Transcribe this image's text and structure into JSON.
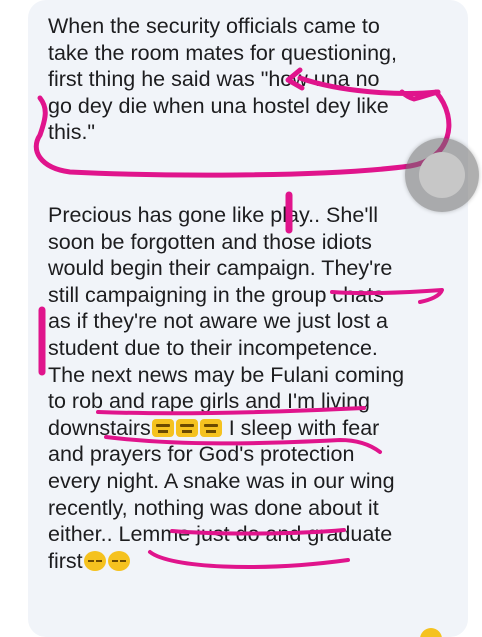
{
  "post": {
    "paragraph_1": {
      "line_1": "When the security officials came to",
      "line_2": "take the room mates for questioning,",
      "line_3": "first thing he said was \"how una no",
      "line_4": "go dey die when una hostel dey like",
      "line_5": "this.\""
    },
    "paragraph_2": {
      "line_1": "Precious has gone like play.. She'll",
      "line_2": "soon be forgotten and those idiots",
      "line_3": "would begin their campaign. They're",
      "line_4": "still campaigning in the group chats",
      "line_5": "as if they're not aware we just lost a",
      "line_6": "student due to their incompetence.",
      "line_7": "The next news may be Fulani coming",
      "line_8": "to rob and rape girls and I'm living",
      "line_9a": "downstairs",
      "line_9b": " I sleep with fear",
      "line_10": "and prayers for God's protection",
      "line_11": "every night. A snake was in our wing",
      "line_12": "recently, nothing was done about it",
      "line_13": "either.. Lemme just do and graduate",
      "line_14": "first"
    }
  },
  "emojis": {
    "downstairs_emojis": [
      "exhausted-face-emoji",
      "exhausted-face-emoji",
      "exhausted-face-emoji"
    ],
    "first_emojis": [
      "unamused-face-emoji",
      "unamused-face-emoji"
    ]
  },
  "colors": {
    "annotation": "#e0148c",
    "bubble_background": "#f1f4f9",
    "text": "#1d1d1f"
  }
}
